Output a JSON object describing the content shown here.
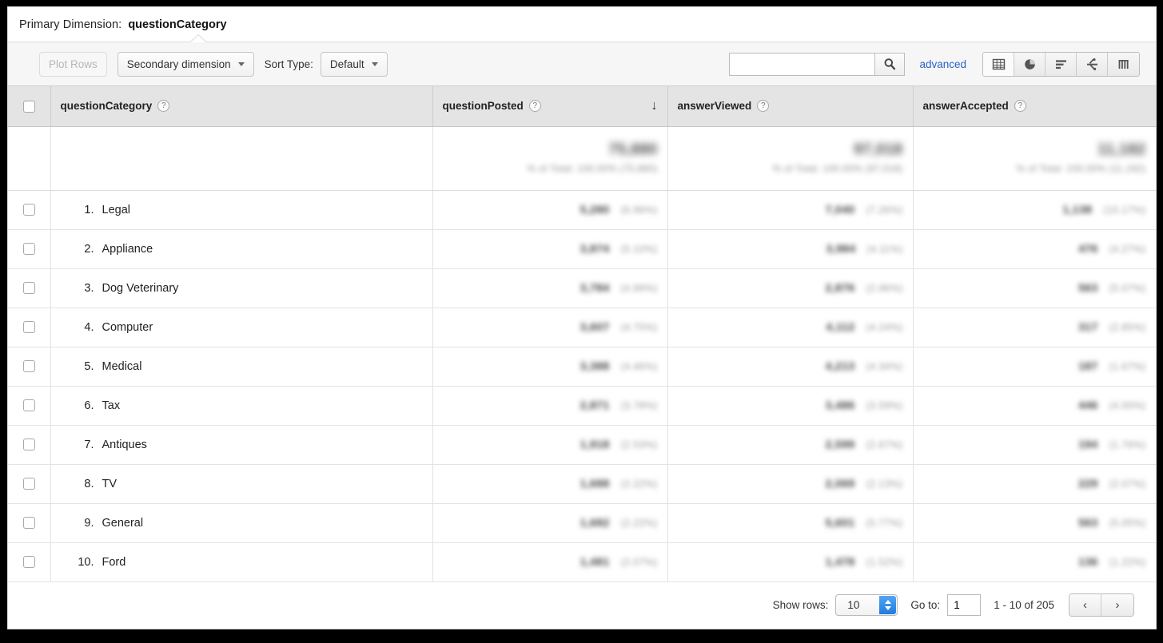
{
  "primary_dimension": {
    "label": "Primary Dimension:",
    "value": "questionCategory"
  },
  "toolbar": {
    "plot_rows_label": "Plot Rows",
    "secondary_dimension_label": "Secondary dimension",
    "sort_type_label": "Sort Type:",
    "sort_type_value": "Default",
    "search_value": "",
    "search_placeholder": "",
    "search_icon": "search-icon",
    "advanced_label": "advanced",
    "view_buttons": [
      {
        "name": "table-view-icon",
        "active": true
      },
      {
        "name": "pie-chart-view-icon",
        "active": false
      },
      {
        "name": "bar-chart-view-icon",
        "active": false
      },
      {
        "name": "comparison-view-icon",
        "active": false
      },
      {
        "name": "pivot-view-icon",
        "active": false
      }
    ]
  },
  "table": {
    "columns": [
      {
        "key": "questionCategory",
        "label": "questionCategory",
        "help": "?",
        "sorted": false
      },
      {
        "key": "questionPosted",
        "label": "questionPosted",
        "help": "?",
        "sorted": true,
        "sort_dir": "↓"
      },
      {
        "key": "answerViewed",
        "label": "answerViewed",
        "help": "?",
        "sorted": false
      },
      {
        "key": "answerAccepted",
        "label": "answerAccepted",
        "help": "?",
        "sorted": false
      }
    ],
    "summary": {
      "questionPosted": {
        "value": "75,880",
        "subtext": "% of Total: 100.00% (75,880)",
        "redacted": true
      },
      "answerViewed": {
        "value": "97,018",
        "subtext": "% of Total: 100.00% (97,018)",
        "redacted": true
      },
      "answerAccepted": {
        "value": "11,182",
        "subtext": "% of Total: 100.00% (11,182)",
        "redacted": true
      }
    },
    "rows": [
      {
        "index": "1.",
        "dimension": "Legal",
        "questionPosted": "5,280",
        "questionPostedPct": "(6.96%)",
        "answerViewed": "7,040",
        "answerViewedPct": "(7.26%)",
        "answerAccepted": "1,138",
        "answerAcceptedPct": "(10.17%)"
      },
      {
        "index": "2.",
        "dimension": "Appliance",
        "questionPosted": "3,874",
        "questionPostedPct": "(5.10%)",
        "answerViewed": "3,984",
        "answerViewedPct": "(4.11%)",
        "answerAccepted": "476",
        "answerAcceptedPct": "(4.27%)"
      },
      {
        "index": "3.",
        "dimension": "Dog Veterinary",
        "questionPosted": "3,784",
        "questionPostedPct": "(4.99%)",
        "answerViewed": "2,876",
        "answerViewedPct": "(2.96%)",
        "answerAccepted": "563",
        "answerAcceptedPct": "(5.07%)"
      },
      {
        "index": "4.",
        "dimension": "Computer",
        "questionPosted": "3,607",
        "questionPostedPct": "(4.75%)",
        "answerViewed": "4,112",
        "answerViewedPct": "(4.24%)",
        "answerAccepted": "317",
        "answerAcceptedPct": "(2.85%)"
      },
      {
        "index": "5.",
        "dimension": "Medical",
        "questionPosted": "3,388",
        "questionPostedPct": "(4.46%)",
        "answerViewed": "4,213",
        "answerViewedPct": "(4.34%)",
        "answerAccepted": "187",
        "answerAcceptedPct": "(1.67%)"
      },
      {
        "index": "6.",
        "dimension": "Tax",
        "questionPosted": "2,871",
        "questionPostedPct": "(3.78%)",
        "answerViewed": "3,486",
        "answerViewedPct": "(3.59%)",
        "answerAccepted": "446",
        "answerAcceptedPct": "(4.00%)"
      },
      {
        "index": "7.",
        "dimension": "Antiques",
        "questionPosted": "1,918",
        "questionPostedPct": "(2.53%)",
        "answerViewed": "2,599",
        "answerViewedPct": "(2.67%)",
        "answerAccepted": "194",
        "answerAcceptedPct": "(1.76%)"
      },
      {
        "index": "8.",
        "dimension": "TV",
        "questionPosted": "1,688",
        "questionPostedPct": "(2.22%)",
        "answerViewed": "2,069",
        "answerViewedPct": "(2.13%)",
        "answerAccepted": "229",
        "answerAcceptedPct": "(2.07%)"
      },
      {
        "index": "9.",
        "dimension": "General",
        "questionPosted": "1,682",
        "questionPostedPct": "(2.22%)",
        "answerViewed": "5,601",
        "answerViewedPct": "(5.77%)",
        "answerAccepted": "563",
        "answerAcceptedPct": "(5.05%)"
      },
      {
        "index": "10.",
        "dimension": "Ford",
        "questionPosted": "1,481",
        "questionPostedPct": "(2.07%)",
        "answerViewed": "1,478",
        "answerViewedPct": "(1.52%)",
        "answerAccepted": "136",
        "answerAcceptedPct": "(1.22%)"
      }
    ]
  },
  "footer": {
    "show_rows_label": "Show rows:",
    "show_rows_value": "10",
    "goto_label": "Go to:",
    "goto_value": "1",
    "range_text": "1 - 10 of 205",
    "prev_label": "‹",
    "next_label": "›"
  },
  "colors": {
    "link": "#2b62c6",
    "header_bg": "#e4e4e4",
    "stepper_blue": "#1f7ce0"
  }
}
